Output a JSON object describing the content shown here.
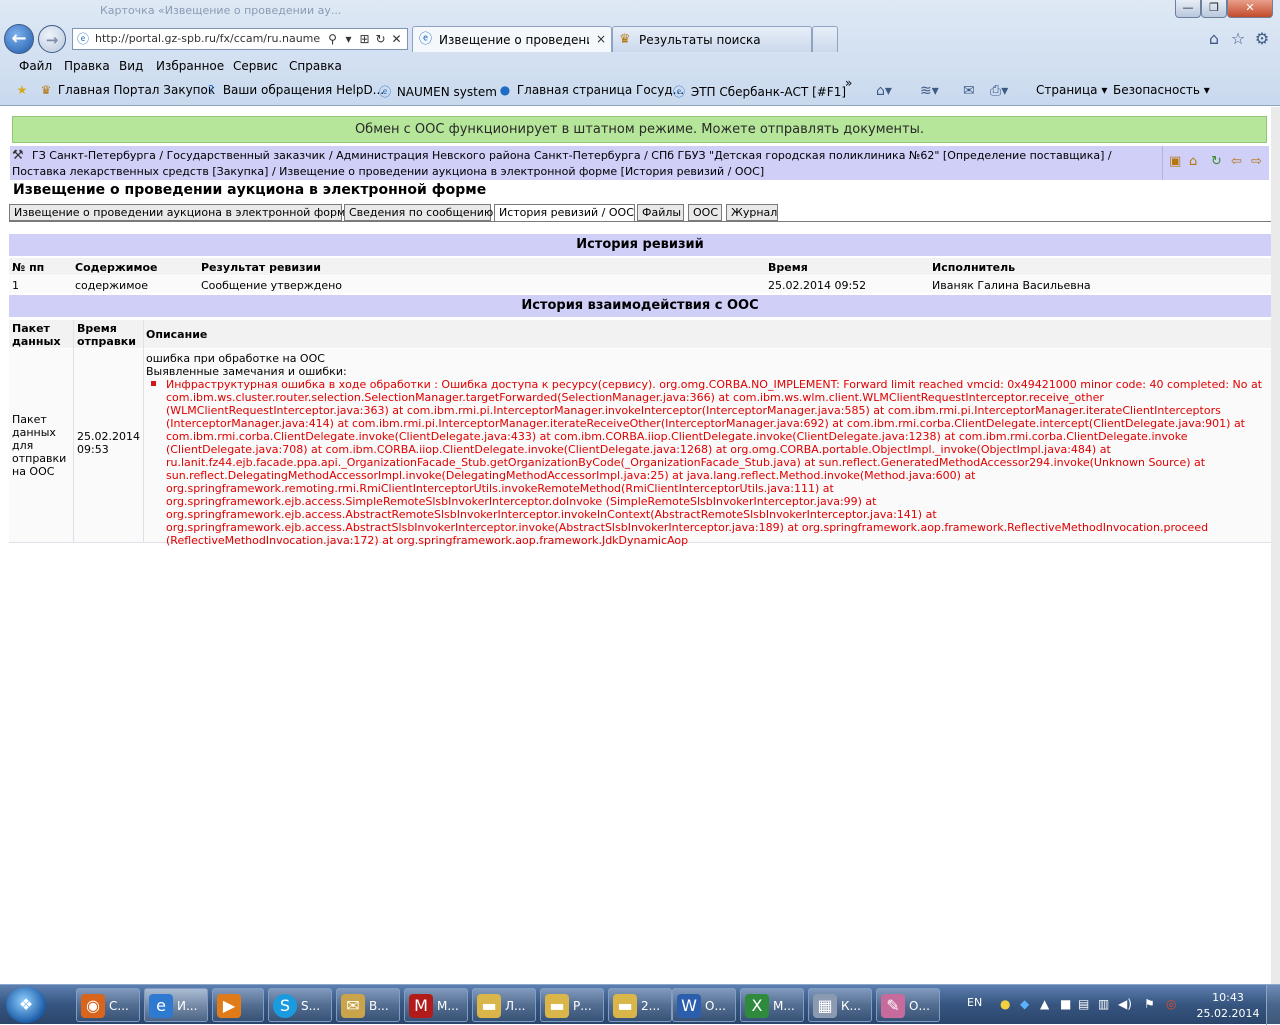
{
  "browser": {
    "ghost_title": "Карточка «Извещение о проведении ау...",
    "window_controls": {
      "min": "—",
      "max": "❐",
      "close": "✕"
    },
    "address_url": "http://portal.gz-spb.ru/fx/ccam/ru.naumen",
    "tabs": [
      {
        "label": "Извещение о проведении ...",
        "close": "×"
      },
      {
        "label": "Результаты поиска"
      }
    ],
    "menu": [
      "Файл",
      "Правка",
      "Вид",
      "Избранное",
      "Сервис",
      "Справка"
    ],
    "favorites": [
      "Главная Портал Закупок",
      "Ваши обращения  HelpD...",
      "NAUMEN system",
      "Главная страница  Госуд...",
      "ЭТП Сбербанк-АСТ [#F1]"
    ],
    "favorites_more": "»",
    "commands": {
      "page": "Страница ▾",
      "safety": "Безопасность ▾"
    }
  },
  "page": {
    "banner": "Обмен с ООС функционирует в штатном режиме. Можете отправлять документы.",
    "breadcrumb": "ГЗ Санкт-Петербурга / Государственный заказчик / Администрация Невского района Санкт-Петербурга / СПб ГБУЗ \"Детская городская поликлиника №62\" [Определение поставщика] / Поставка лекарственных средств [Закупка] / Извещение о проведении аукциона в электронной форме [История ревизий / ООС]",
    "title": "Извещение о проведении аукциона в электронной форме",
    "tabs": [
      "Извещение о проведении аукциона в электронной форме",
      "Сведения по сообщению",
      "История ревизий / ООС",
      "Файлы",
      "ООС",
      "Журнал"
    ],
    "revisions": {
      "heading": "История ревизий",
      "columns": [
        "№ пп",
        "Содержимое",
        "Результат ревизии",
        "Время",
        "Исполнитель"
      ],
      "rows": [
        [
          "1",
          "содержимое",
          "Сообщение утверждено",
          "25.02.2014 09:52",
          "Иваняк Галина Васильевна"
        ]
      ]
    },
    "interaction": {
      "heading": "История взаимодействия с ООС",
      "columns": [
        "Пакет данных",
        "Время отправки",
        "Описание"
      ],
      "row": {
        "packet": "Пакет данных для отправки на ООС",
        "time": "25.02.2014 09:53",
        "desc_line1": "ошибка при обработке на ООС",
        "desc_line2": "Выявленные замечания и ошибки:",
        "error": "Инфраструктурная ошибка в ходе обработки : Ошибка доступа к ресурсу(сервису). org.omg.CORBA.NO_IMPLEMENT: Forward limit reached vmcid: 0x49421000 minor code: 40 completed: No at com.ibm.ws.cluster.router.selection.SelectionManager.targetForwarded(SelectionManager.java:366) at com.ibm.ws.wlm.client.WLMClientRequestInterceptor.receive_other (WLMClientRequestInterceptor.java:363) at com.ibm.rmi.pi.InterceptorManager.invokeInterceptor(InterceptorManager.java:585) at com.ibm.rmi.pi.InterceptorManager.iterateClientInterceptors (InterceptorManager.java:414) at com.ibm.rmi.pi.InterceptorManager.iterateReceiveOther(InterceptorManager.java:692) at com.ibm.rmi.corba.ClientDelegate.intercept(ClientDelegate.java:901) at com.ibm.rmi.corba.ClientDelegate.invoke(ClientDelegate.java:433) at com.ibm.CORBA.iiop.ClientDelegate.invoke(ClientDelegate.java:1238) at com.ibm.rmi.corba.ClientDelegate.invoke (ClientDelegate.java:708) at com.ibm.CORBA.iiop.ClientDelegate.invoke(ClientDelegate.java:1268) at org.omg.CORBA.portable.ObjectImpl._invoke(ObjectImpl.java:484) at ru.lanit.fz44.ejb.facade.ppa.api._OrganizationFacade_Stub.getOrganizationByCode(_OrganizationFacade_Stub.java) at sun.reflect.GeneratedMethodAccessor294.invoke(Unknown Source) at sun.reflect.DelegatingMethodAccessorImpl.invoke(DelegatingMethodAccessorImpl.java:25) at java.lang.reflect.Method.invoke(Method.java:600) at org.springframework.remoting.rmi.RmiClientInterceptorUtils.invokeRemoteMethod(RmiClientInterceptorUtils.java:111) at org.springframework.ejb.access.SimpleRemoteSlsbInvokerInterceptor.doInvoke (SimpleRemoteSlsbInvokerInterceptor.java:99) at org.springframework.ejb.access.AbstractRemoteSlsbInvokerInterceptor.invokeInContext(AbstractRemoteSlsbInvokerInterceptor.java:141) at org.springframework.ejb.access.AbstractSlsbInvokerInterceptor.invoke(AbstractSlsbInvokerInterceptor.java:189) at org.springframework.aop.framework.ReflectiveMethodInvocation.proceed (ReflectiveMethodInvocation.java:172) at org.springframework.aop.framework.JdkDynamicAop"
      }
    }
  },
  "taskbar": {
    "items": [
      {
        "label": "С...",
        "icon": "firefox-icon"
      },
      {
        "label": "И...",
        "icon": "ie-icon"
      },
      {
        "label": "",
        "icon": "media-player-icon"
      },
      {
        "label": "S...",
        "icon": "skype-icon"
      },
      {
        "label": "В...",
        "icon": "mail-icon"
      },
      {
        "label": "М...",
        "icon": "mcafee-icon"
      },
      {
        "label": "Л...",
        "icon": "folder-icon"
      },
      {
        "label": "Р...",
        "icon": "folder-icon"
      },
      {
        "label": "2...",
        "icon": "folder-icon"
      },
      {
        "label": "О...",
        "icon": "word-icon"
      },
      {
        "label": "М...",
        "icon": "excel-icon"
      },
      {
        "label": "К...",
        "icon": "calculator-icon"
      },
      {
        "label": "О...",
        "icon": "paint-icon"
      }
    ],
    "language": "EN",
    "time": "10:43",
    "date": "25.02.2014"
  }
}
